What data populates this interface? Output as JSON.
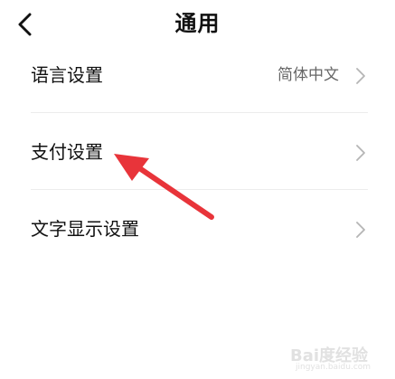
{
  "header": {
    "title": "通用"
  },
  "settings": {
    "items": [
      {
        "label": "语言设置",
        "value": "简体中文"
      },
      {
        "label": "支付设置"
      },
      {
        "label": "文字显示设置"
      }
    ]
  },
  "watermark": {
    "text": "Bai度经验",
    "sub": "jingyan.baidu.com"
  },
  "colors": {
    "text_primary": "#111111",
    "text_secondary": "#666666",
    "chevron": "#b5b5b5",
    "divider": "#ececec",
    "annotation_arrow": "#e8343a"
  },
  "icons": {
    "back": "chevron-left-icon",
    "row_chevron": "chevron-right-icon"
  }
}
